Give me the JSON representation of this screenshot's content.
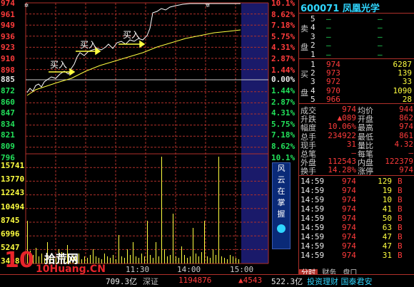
{
  "stock": {
    "code": "600071",
    "name": "凤凰光学"
  },
  "chart": {
    "price_labels_top": [
      "974",
      "961",
      "949",
      "936",
      "923",
      "910",
      "898"
    ],
    "price_prev": "885",
    "price_labels_bottom": [
      "872",
      "860",
      "847",
      "834",
      "821",
      "809",
      "796"
    ],
    "pct_labels_top": [
      "10.1%",
      "8.62%",
      "7.18%",
      "5.75%",
      "4.31%",
      "2.87%",
      "1.44%"
    ],
    "pct_zero": "0.00%",
    "pct_labels_bottom": [
      "1.44%",
      "2.87%",
      "4.31%",
      "5.75%",
      "7.18%",
      "8.62%",
      "10.1%"
    ],
    "vol_labels": [
      "15741",
      "13770",
      "12243",
      "10494",
      "8745",
      "6996",
      "5247",
      "3498"
    ],
    "times": [
      "11:30",
      "14:00",
      "15:00"
    ],
    "annotations": [
      "买入",
      "买入",
      "买入"
    ]
  },
  "side_button": [
    "风",
    "云",
    "在",
    "掌",
    "握"
  ],
  "orderbook": {
    "ask_label": [
      "卖",
      "盘"
    ],
    "bid_label": [
      "买",
      "盘"
    ],
    "asks": [
      {
        "level": "5",
        "price": "—",
        "vol": "—"
      },
      {
        "level": "4",
        "price": "—",
        "vol": "—"
      },
      {
        "level": "3",
        "price": "—",
        "vol": "—"
      },
      {
        "level": "2",
        "price": "—",
        "vol": "—"
      },
      {
        "level": "1",
        "price": "—",
        "vol": "—"
      }
    ],
    "bids": [
      {
        "level": "1",
        "price": "974",
        "vol": "6287"
      },
      {
        "level": "2",
        "price": "973",
        "vol": "139"
      },
      {
        "level": "3",
        "price": "972",
        "vol": "33"
      },
      {
        "level": "4",
        "price": "970",
        "vol": "1090"
      },
      {
        "level": "5",
        "price": "966",
        "vol": "28"
      }
    ]
  },
  "stats": [
    {
      "k1": "成交",
      "v1": "974",
      "k2": "均价",
      "v2": "944"
    },
    {
      "k1": "升跌",
      "v1": "▲089",
      "k2": "开盘",
      "v2": "862"
    },
    {
      "k1": "幅度",
      "v1": "10.06%",
      "k2": "最高",
      "v2": "974"
    },
    {
      "k1": "总手",
      "v1": "234922",
      "k2": "最低",
      "v2": "861"
    },
    {
      "k1": "现手",
      "v1": "31",
      "k2": "量比",
      "v2": "4.32"
    },
    {
      "k1": "总笔",
      "v1": "—",
      "k2": "每笔",
      "v2": "—"
    },
    {
      "k1": "外盘",
      "v1": "112543",
      "k2": "内盘",
      "v2": "122379"
    },
    {
      "k1": "换手",
      "v1": "14.28%",
      "k2": "涨停",
      "v2": "974"
    }
  ],
  "ticks": [
    {
      "t": "14:59",
      "p": "974",
      "v": "129"
    },
    {
      "t": "14:59",
      "p": "974",
      "v": "19"
    },
    {
      "t": "14:59",
      "p": "974",
      "v": "10"
    },
    {
      "t": "14:59",
      "p": "974",
      "v": "41"
    },
    {
      "t": "14:59",
      "p": "974",
      "v": "50"
    },
    {
      "t": "14:59",
      "p": "974",
      "v": "63"
    },
    {
      "t": "14:59",
      "p": "974",
      "v": "47"
    },
    {
      "t": "14:59",
      "p": "974",
      "v": "47"
    },
    {
      "t": "14:59",
      "p": "974",
      "v": "31"
    }
  ],
  "tabs": [
    "分时",
    "财务",
    "盘口"
  ],
  "footer": {
    "left_value": "709.3亿",
    "mid_label": "深证",
    "mid_value": "1194876",
    "mid_change": "▲4543",
    "right_value": "522.3亿",
    "ticker": "投资理财 国泰君安"
  },
  "watermark": {
    "brand": "10",
    "cn": "拾荒网",
    "url": "10Huang.CN"
  },
  "colors": {
    "up": "#ff3b3b",
    "down": "#22e05a",
    "grid": "#b0302a",
    "price_line": "#ffffff",
    "avg_line": "#ffff40",
    "volume": "#ffff40"
  }
}
